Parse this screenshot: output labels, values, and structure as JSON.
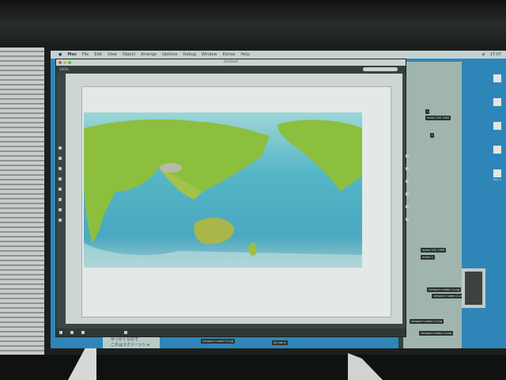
{
  "menubar": {
    "apple": "",
    "items": [
      "Max",
      "File",
      "Edit",
      "View",
      "Object",
      "Arrange",
      "Options",
      "Debug",
      "Window",
      "Extras",
      "Help"
    ],
    "clock": "17:07"
  },
  "window": {
    "title": "(Untitled)",
    "zoom": "100%"
  },
  "patcher": {
    "objects": [
      "r",
      "metro 500 1000",
      "r",
      "metro 500 1000",
      "metro 2",
      "jit.matrix",
      "viewport nodeiz 1.png",
      "viewport nodeiz 2.png",
      "viewport nodeiz 3.png",
      "viewport nodeiz 4.png",
      "viewport nodeiz 5.png"
    ]
  },
  "note": {
    "line1": "せっかくなので",
    "line2": "これはスクリーンショ"
  },
  "desktop": {
    "items": [
      "",
      "",
      "",
      "",
      "test_x"
    ]
  },
  "colors": {
    "desktop": "#2e86b8",
    "land": "#8cbf3e",
    "ocean": "#54b6c6"
  }
}
